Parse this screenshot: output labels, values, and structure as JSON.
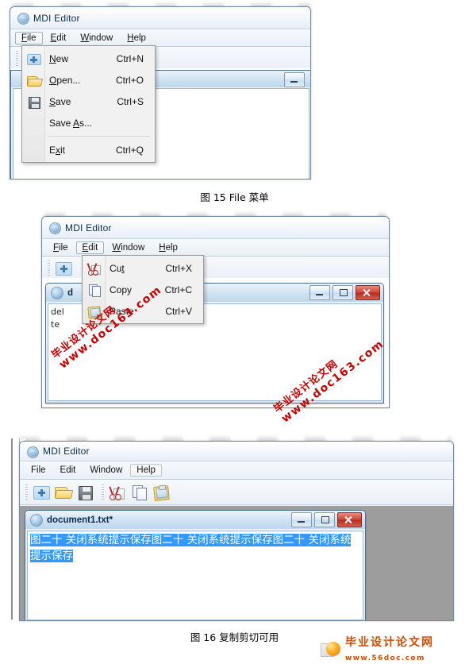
{
  "document": {
    "figures": [
      {
        "caption": "图 15 File 菜单",
        "window": {
          "app_title": "MDI Editor",
          "menubar": [
            {
              "label": "File",
              "mnemonic": "F",
              "state": "open"
            },
            {
              "label": "Edit",
              "mnemonic": "E",
              "state": "normal"
            },
            {
              "label": "Window",
              "mnemonic": "W",
              "state": "normal"
            },
            {
              "label": "Help",
              "mnemonic": "H",
              "state": "normal"
            }
          ],
          "dropdown": {
            "owner": "File",
            "items": [
              {
                "label": "New",
                "mnemonic": "N",
                "accel": "Ctrl+N",
                "icon": "new-document-icon"
              },
              {
                "label": "Open...",
                "mnemonic": "O",
                "accel": "Ctrl+O",
                "icon": "open-folder-icon"
              },
              {
                "label": "Save",
                "mnemonic": "S",
                "accel": "Ctrl+S",
                "icon": "save-floppy-icon"
              },
              {
                "label": "Save As...",
                "mnemonic": "A",
                "accel": "",
                "icon": ""
              },
              {
                "separator": true
              },
              {
                "label": "Exit",
                "mnemonic": "x",
                "accel": "Ctrl+Q",
                "icon": ""
              }
            ]
          },
          "toolbar": [
            {
              "name": "paste-button",
              "icon": "paste-clipboard-icon"
            }
          ]
        }
      },
      {
        "caption": "",
        "window": {
          "app_title": "MDI Editor",
          "menubar": [
            {
              "label": "File",
              "mnemonic": "F",
              "state": "normal"
            },
            {
              "label": "Edit",
              "mnemonic": "E",
              "state": "open"
            },
            {
              "label": "Window",
              "mnemonic": "W",
              "state": "normal"
            },
            {
              "label": "Help",
              "mnemonic": "H",
              "state": "normal"
            }
          ],
          "dropdown": {
            "owner": "Edit",
            "items": [
              {
                "label": "Cut",
                "mnemonic": "t",
                "accel": "Ctrl+X",
                "icon": "cut-scissors-icon"
              },
              {
                "label": "Copy",
                "mnemonic": "C",
                "accel": "Ctrl+C",
                "icon": "copy-pages-icon"
              },
              {
                "label": "Paste",
                "mnemonic": "P",
                "accel": "Ctrl+V",
                "icon": "paste-clipboard-icon"
              }
            ]
          },
          "toolbar": [
            {
              "name": "new-button",
              "icon": "new-document-icon"
            }
          ],
          "child_window": {
            "title": "d",
            "body_text": "del\nte",
            "buttons": [
              "minimize",
              "maximize",
              "close"
            ]
          }
        }
      },
      {
        "caption": "图 16 复制剪切可用",
        "window": {
          "app_title": "MDI Editor",
          "menubar": [
            {
              "label": "File",
              "mnemonic": "",
              "state": "normal"
            },
            {
              "label": "Edit",
              "mnemonic": "",
              "state": "normal"
            },
            {
              "label": "Window",
              "mnemonic": "",
              "state": "normal"
            },
            {
              "label": "Help",
              "mnemonic": "",
              "state": "highlighted"
            }
          ],
          "toolbar": [
            {
              "name": "new-button",
              "icon": "new-document-icon"
            },
            {
              "name": "open-button",
              "icon": "open-folder-icon"
            },
            {
              "name": "save-button",
              "icon": "save-floppy-icon"
            },
            {
              "name": "cut-button",
              "icon": "cut-scissors-icon"
            },
            {
              "name": "copy-button",
              "icon": "copy-pages-icon"
            },
            {
              "name": "paste-button",
              "icon": "paste-clipboard-icon"
            }
          ],
          "child_window": {
            "title": "document1.txt*",
            "selected_text": "图二十 关闭系统提示保存图二十 关闭系统提示保存图二十 关闭系统提示保存",
            "buttons": [
              "minimize",
              "maximize",
              "close"
            ]
          }
        }
      }
    ],
    "watermarks": [
      {
        "line1": "毕业设计论文网",
        "line2": "www.doc163.com"
      },
      {
        "line1": "毕业设计论文网",
        "line2": "www.doc163.com"
      }
    ],
    "footer_logo": {
      "title": "毕业设计论文网",
      "url": "www.56doc.com"
    },
    "colors": {
      "selection_blue": "#3399ff",
      "watermark_red": "#cc0000",
      "logo_orange": "#d64a00",
      "close_red": "#cf4636",
      "mdi_gray": "#9d9d9d"
    }
  }
}
